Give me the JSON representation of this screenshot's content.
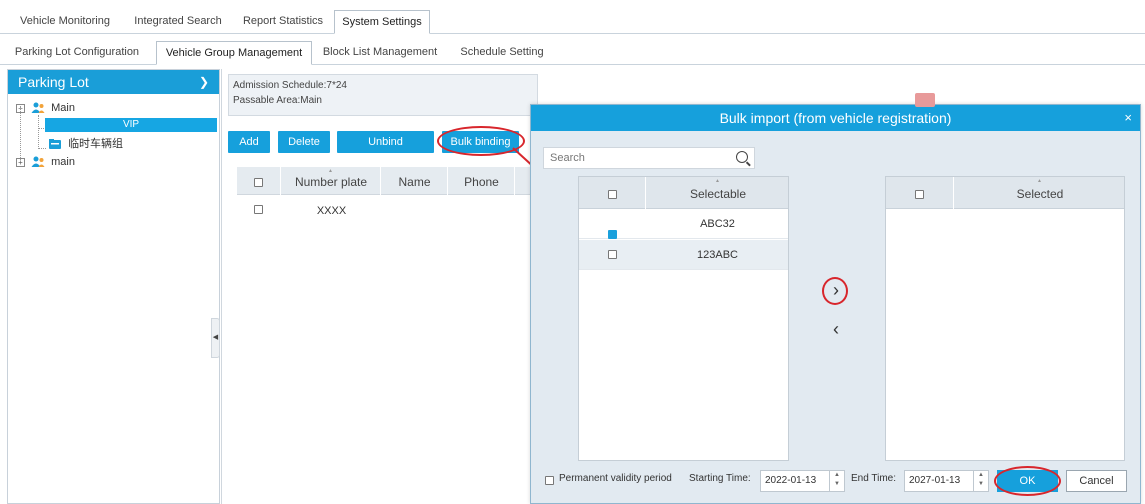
{
  "top_tabs": [
    "Vehicle Monitoring",
    "Integrated Search",
    "Report Statistics",
    "System Settings"
  ],
  "sub_tabs": [
    "Parking Lot Configuration",
    "Vehicle Group Management",
    "Block List Management",
    "Schedule Setting"
  ],
  "tree": {
    "header": "Parking Lot",
    "nodes": {
      "main_upper": "Main",
      "vip": "VIP",
      "temp_group": "临时车辆组",
      "main_lower": "main"
    }
  },
  "info": {
    "schedule": "Admission Schedule:7*24",
    "area": "Passable Area:Main"
  },
  "toolbar": {
    "add": "Add",
    "delete": "Delete",
    "unbind": "Unbind",
    "bulk_binding": "Bulk binding"
  },
  "table": {
    "columns": [
      "Number plate",
      "Name",
      "Phone"
    ],
    "rows": [
      {
        "plate": "XXXX"
      }
    ]
  },
  "modal": {
    "title": "Bulk import (from vehicle registration)",
    "close": "×",
    "search_placeholder": "Search",
    "selectable_header": "Selectable",
    "selected_header": "Selected",
    "selectable_items": [
      {
        "plate": "ABC32",
        "checked": true
      },
      {
        "plate": "123ABC",
        "checked": false
      }
    ],
    "move_right": "›",
    "move_left": "‹",
    "permanent_label": "Permanent validity period",
    "start_label": "Starting Time:",
    "start_value": "2022-01-13",
    "end_label": "End Time:",
    "end_value": "2027-01-13",
    "ok": "OK",
    "cancel": "Cancel"
  },
  "colors": {
    "accent": "#16a0dc",
    "annotation": "#d8262c"
  }
}
